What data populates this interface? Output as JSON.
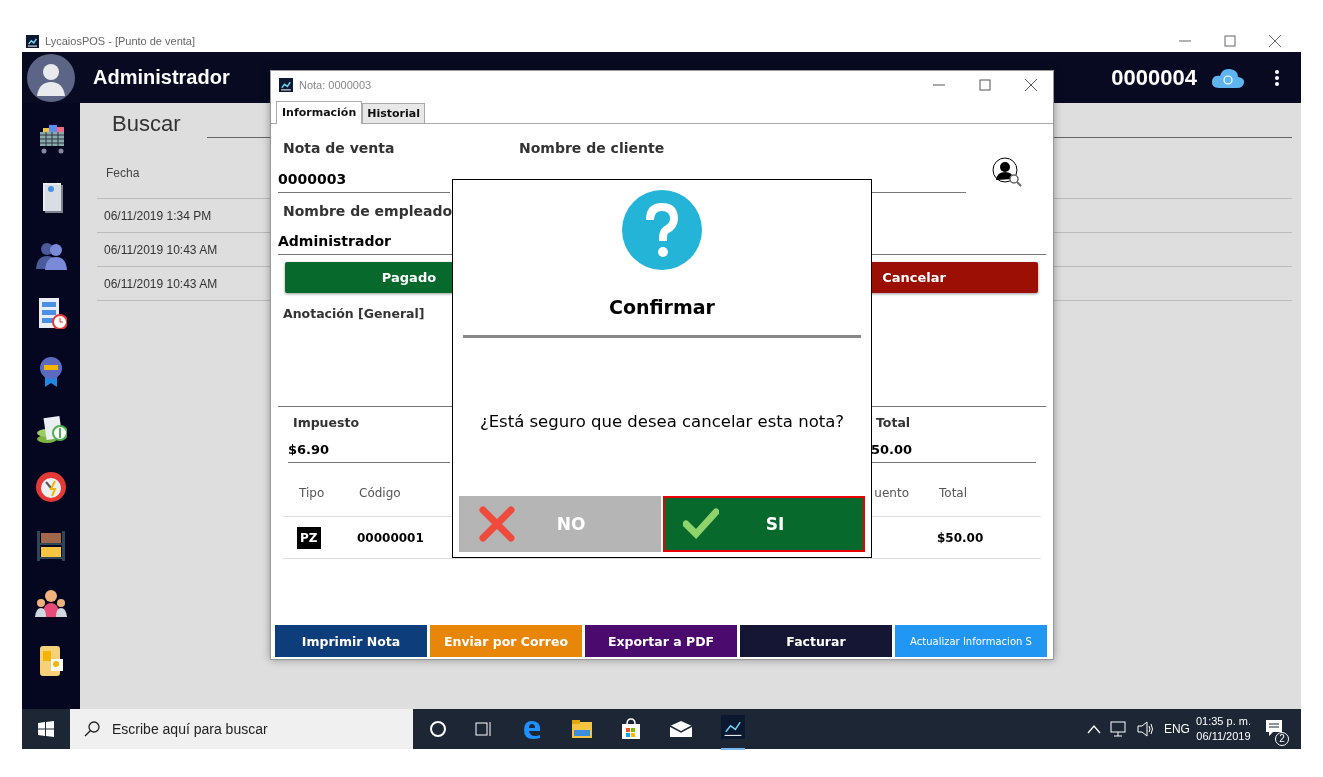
{
  "window": {
    "title": "LycaiosPOS - [Punto de venta]"
  },
  "header": {
    "user": "Administrador",
    "note_number": "0000004"
  },
  "search": {
    "label": "Buscar"
  },
  "list": {
    "columns": [
      "Fecha"
    ],
    "rows": [
      "06/11/2019 1:34 PM",
      "06/11/2019 10:43 AM",
      "06/11/2019 10:43 AM"
    ]
  },
  "nota_window": {
    "title": "Nota: 0000003",
    "tabs": [
      {
        "label": "Información",
        "selected": true
      },
      {
        "label": "Historial",
        "selected": false
      }
    ],
    "sale_note": {
      "label": "Nota de venta",
      "value": "0000003"
    },
    "customer": {
      "label": "Nombre de cliente"
    },
    "employee": {
      "label": "Nombre de empleado",
      "value": "Administrador"
    },
    "status_buttons": [
      {
        "label": "Pagado",
        "kind": "paid"
      },
      {
        "label": "Cancelar",
        "kind": "cancel"
      }
    ],
    "annotation_label": "Anotación [General]",
    "totals": [
      {
        "label": "Impuesto",
        "value": "$6.90"
      },
      {
        "label": "Total",
        "value": "50.00"
      }
    ],
    "table": {
      "columns": [
        "Tipo",
        "Código",
        "uento",
        "Total"
      ],
      "rows": [
        {
          "type": "PZ",
          "code": "00000001",
          "total": "$50.00"
        }
      ]
    },
    "actions": [
      {
        "label": "Imprimir Nota",
        "color": "#0d3d7a"
      },
      {
        "label": "Enviar por Correo",
        "color": "#e8860a"
      },
      {
        "label": "Exportar a PDF",
        "color": "#4b0b6e"
      },
      {
        "label": "Facturar",
        "color": "#141633"
      },
      {
        "label": "Actualizar Informacion S",
        "color": "#2196f3"
      }
    ]
  },
  "dialog": {
    "title": "Confirmar",
    "message": "¿Está seguro que desea cancelar esta nota?",
    "buttons": [
      {
        "label": "NO",
        "kind": "no",
        "selected": false
      },
      {
        "label": "SI",
        "kind": "yes",
        "selected": true
      }
    ]
  },
  "taskbar": {
    "search_placeholder": "Escribe aquí para buscar",
    "language": "ENG",
    "time": "01:35 p. m.",
    "date": "06/11/2019",
    "notifications": "2"
  }
}
